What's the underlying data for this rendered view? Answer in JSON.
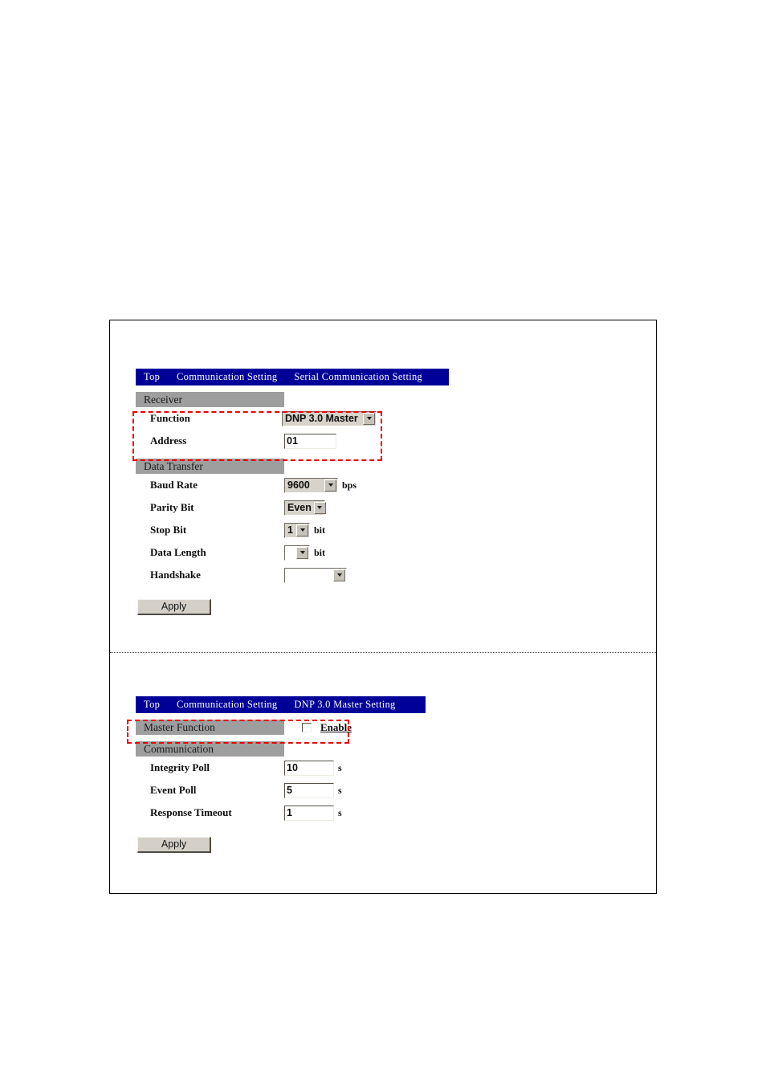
{
  "document": {
    "page_background": "#ffffff",
    "frame_border_color": "#000000"
  },
  "colors": {
    "titlebar_blue": "#000099",
    "group_header_gray": "#9e9e9e",
    "annotation_red": "#ee0000",
    "button_face": "#d4d0c8"
  },
  "serial_screen": {
    "breadcrumb": {
      "root": "Top",
      "level1": "Communication Setting",
      "level2": "Serial Communication Setting"
    },
    "groups": [
      {
        "header": "Receiver",
        "fields": [
          {
            "label": "Function",
            "control": "select",
            "value": "DNP 3.0 Master",
            "unit": ""
          },
          {
            "label": "Address",
            "control": "textbox",
            "value": "01",
            "unit": ""
          }
        ]
      },
      {
        "header": "Data Transfer",
        "fields": [
          {
            "label": "Baud Rate",
            "control": "select",
            "value": "9600",
            "unit": "bps"
          },
          {
            "label": "Parity Bit",
            "control": "select",
            "value": "Even",
            "unit": ""
          },
          {
            "label": "Stop Bit",
            "control": "select",
            "value": "1",
            "unit": "bit"
          },
          {
            "label": "Data Length",
            "control": "select",
            "value": "",
            "unit": "bit"
          },
          {
            "label": "Handshake",
            "control": "select",
            "value": "",
            "unit": ""
          }
        ]
      }
    ],
    "apply_label": "Apply"
  },
  "dnp_screen": {
    "breadcrumb": {
      "root": "Top",
      "level1": "Communication Setting",
      "level2": "DNP 3.0 Master Setting"
    },
    "master_function": {
      "header": "Master Function",
      "checkbox_label": "Enable",
      "checked": false
    },
    "communication": {
      "header": "Communication",
      "fields": [
        {
          "label": "Integrity Poll",
          "control": "textbox",
          "value": "10",
          "unit": "s"
        },
        {
          "label": "Event Poll",
          "control": "textbox",
          "value": "5",
          "unit": "s"
        },
        {
          "label": "Response Timeout",
          "control": "textbox",
          "value": "1",
          "unit": "s"
        }
      ]
    },
    "apply_label": "Apply"
  }
}
